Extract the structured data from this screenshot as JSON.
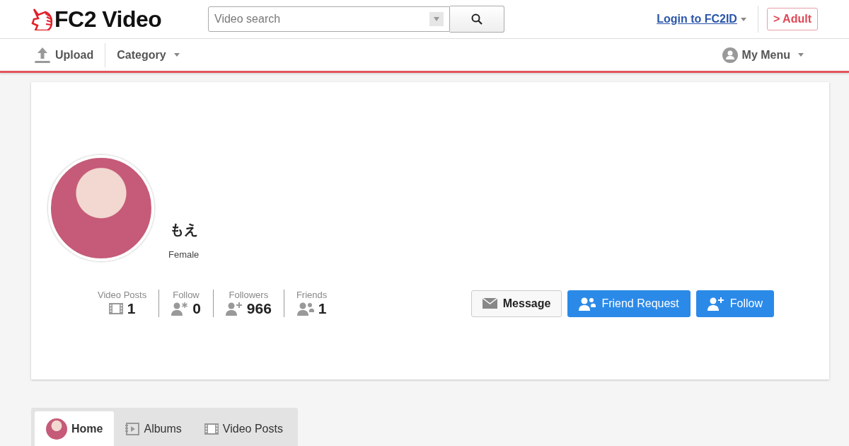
{
  "header": {
    "logo": "FC2 Video",
    "search": {
      "placeholder": "Video search"
    },
    "login": "Login to FC2ID",
    "adult": "> Adult"
  },
  "nav": {
    "items": [
      {
        "label": "Upload",
        "kind": "upload"
      },
      {
        "label": "Category",
        "kind": "dropdown"
      }
    ],
    "my_menu": "My Menu"
  },
  "profile": {
    "name": "もえ",
    "gender": "Female",
    "stats": [
      {
        "label": "Video Posts",
        "value": "1",
        "kind": "film"
      },
      {
        "label": "Follow",
        "value": "0",
        "kind": "follow"
      },
      {
        "label": "Followers",
        "value": "966",
        "kind": "follower"
      },
      {
        "label": "Friends",
        "value": "1",
        "kind": "friends"
      }
    ],
    "buttons": [
      {
        "label": "Message",
        "kind": "message"
      },
      {
        "label": "Friend Request",
        "kind": "friend"
      },
      {
        "label": "Follow",
        "kind": "follow"
      }
    ]
  },
  "tabs": [
    {
      "label": "Home",
      "kind": "avatar",
      "selected": true
    },
    {
      "label": "Albums",
      "kind": "album",
      "selected": false
    },
    {
      "label": "Video Posts",
      "kind": "film",
      "selected": false
    }
  ]
}
